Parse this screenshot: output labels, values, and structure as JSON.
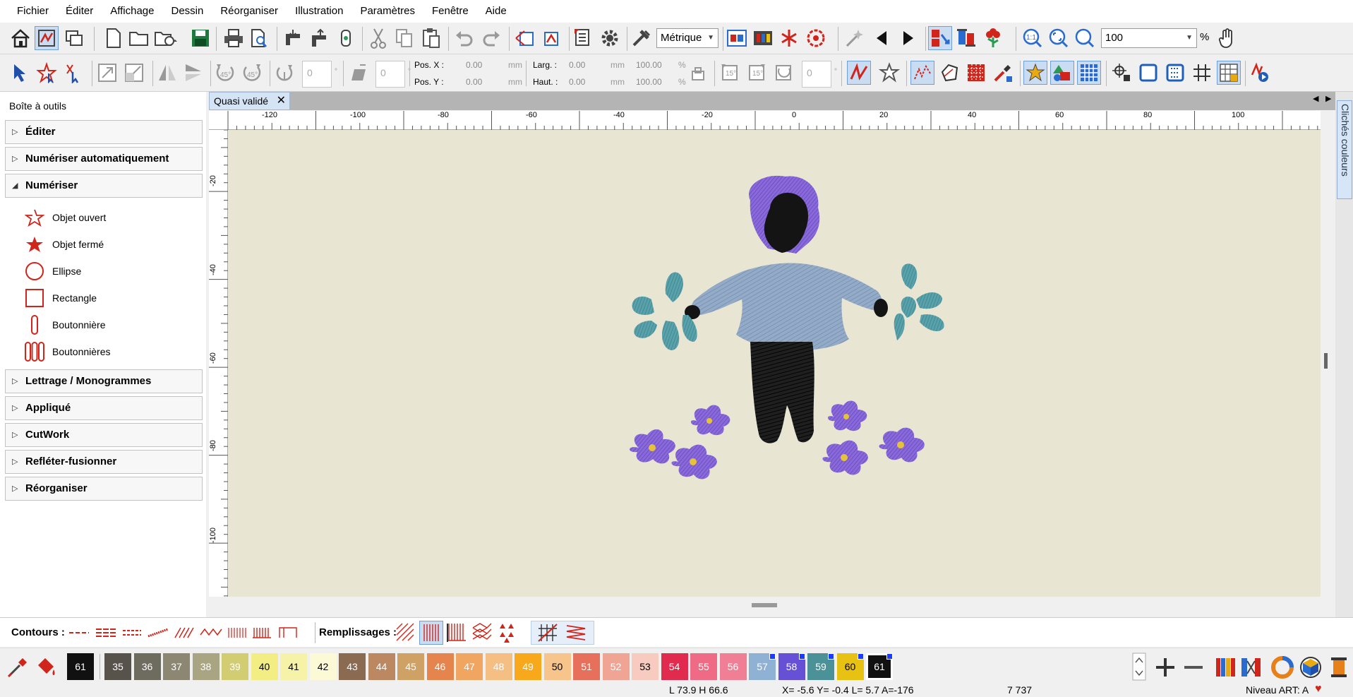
{
  "menubar": {
    "items": [
      "Fichier",
      "Éditer",
      "Affichage",
      "Dessin",
      "Réorganiser",
      "Illustration",
      "Paramètres",
      "Fenêtre",
      "Aide"
    ]
  },
  "toolbar": {
    "units_select": "Métrique",
    "zoom_value": "100",
    "zoom_unit": "%"
  },
  "transform": {
    "rotate_value": "0",
    "slant_value": "0",
    "posx_label": "Pos. X :",
    "posx_value": "0.00",
    "posy_label": "Pos. Y :",
    "posy_value": "0.00",
    "width_label": "Larg. :",
    "width_value": "0.00",
    "height_label": "Haut. :",
    "height_value": "0.00",
    "scale_w": "100.00",
    "scale_h": "100.00",
    "unit_mm": "mm",
    "unit_pct": "%",
    "rot2_value": "0"
  },
  "toolbox": {
    "title": "Boîte à outils",
    "sections": [
      "Éditer",
      "Numériser automatiquement",
      "Numériser",
      "Lettrage / Monogrammes",
      "Appliqué",
      "CutWork",
      "Refléter-fusionner",
      "Réorganiser"
    ],
    "tools": [
      "Objet ouvert",
      "Objet fermé",
      "Ellipse",
      "Rectangle",
      "Boutonnière",
      "Boutonnières"
    ]
  },
  "document": {
    "tab_title": "Quasi validé",
    "ruler_h_labels": [
      "-120",
      "-100",
      "-80",
      "-60",
      "-40",
      "-20",
      "0",
      "20",
      "40",
      "60",
      "80",
      "100"
    ],
    "ruler_v_labels": [
      "-20",
      "-40",
      "-60",
      "-80",
      "-100"
    ]
  },
  "dock": {
    "label": "Clichés couleurs"
  },
  "stitchbar": {
    "contours_label": "Contours :",
    "fills_label": "Remplissages :"
  },
  "palette": {
    "current": "61",
    "swatches": [
      {
        "n": "35",
        "color": "#57524a",
        "text": "#fff"
      },
      {
        "n": "36",
        "color": "#6e6b5f",
        "text": "#fff"
      },
      {
        "n": "37",
        "color": "#8b8772",
        "text": "#fff"
      },
      {
        "n": "38",
        "color": "#a9a582",
        "text": "#fff"
      },
      {
        "n": "39",
        "color": "#d2cc72",
        "text": "#fff"
      },
      {
        "n": "40",
        "color": "#f2ee84",
        "text": "#000"
      },
      {
        "n": "41",
        "color": "#f6f3a8",
        "text": "#000"
      },
      {
        "n": "42",
        "color": "#fbf9d6",
        "text": "#000"
      },
      {
        "n": "43",
        "color": "#8a6a50",
        "text": "#fff"
      },
      {
        "n": "44",
        "color": "#bc8861",
        "text": "#fff"
      },
      {
        "n": "45",
        "color": "#d0a164",
        "text": "#fff"
      },
      {
        "n": "46",
        "color": "#e5844d",
        "text": "#fff"
      },
      {
        "n": "47",
        "color": "#f0a561",
        "text": "#fff"
      },
      {
        "n": "48",
        "color": "#f5be82",
        "text": "#fff"
      },
      {
        "n": "49",
        "color": "#f7a81b",
        "text": "#fff"
      },
      {
        "n": "50",
        "color": "#f7c48c",
        "text": "#000"
      },
      {
        "n": "51",
        "color": "#e6705b",
        "text": "#fff"
      },
      {
        "n": "52",
        "color": "#f0a494",
        "text": "#fff"
      },
      {
        "n": "53",
        "color": "#f8cbc0",
        "text": "#000"
      },
      {
        "n": "54",
        "color": "#e02a4e",
        "text": "#fff"
      },
      {
        "n": "55",
        "color": "#ef6b85",
        "text": "#fff"
      },
      {
        "n": "56",
        "color": "#f07e94",
        "text": "#fff"
      },
      {
        "n": "57",
        "color": "#8fb1d4",
        "text": "#fff"
      },
      {
        "n": "58",
        "color": "#6650d5",
        "text": "#fff"
      },
      {
        "n": "59",
        "color": "#4a9298",
        "text": "#fff"
      },
      {
        "n": "60",
        "color": "#e8c212",
        "text": "#000"
      },
      {
        "n": "61",
        "color": "#111111",
        "text": "#fff"
      }
    ]
  },
  "status": {
    "dims": "L 73.9 H 66.6",
    "coords": "X= -5.6 Y= -0.4 L= 5.7 A=-176",
    "stitches": "7 737",
    "level": "Niveau ART: A"
  },
  "colors": {
    "accent": "#d0251b",
    "canvas": "#e9e5d3"
  }
}
